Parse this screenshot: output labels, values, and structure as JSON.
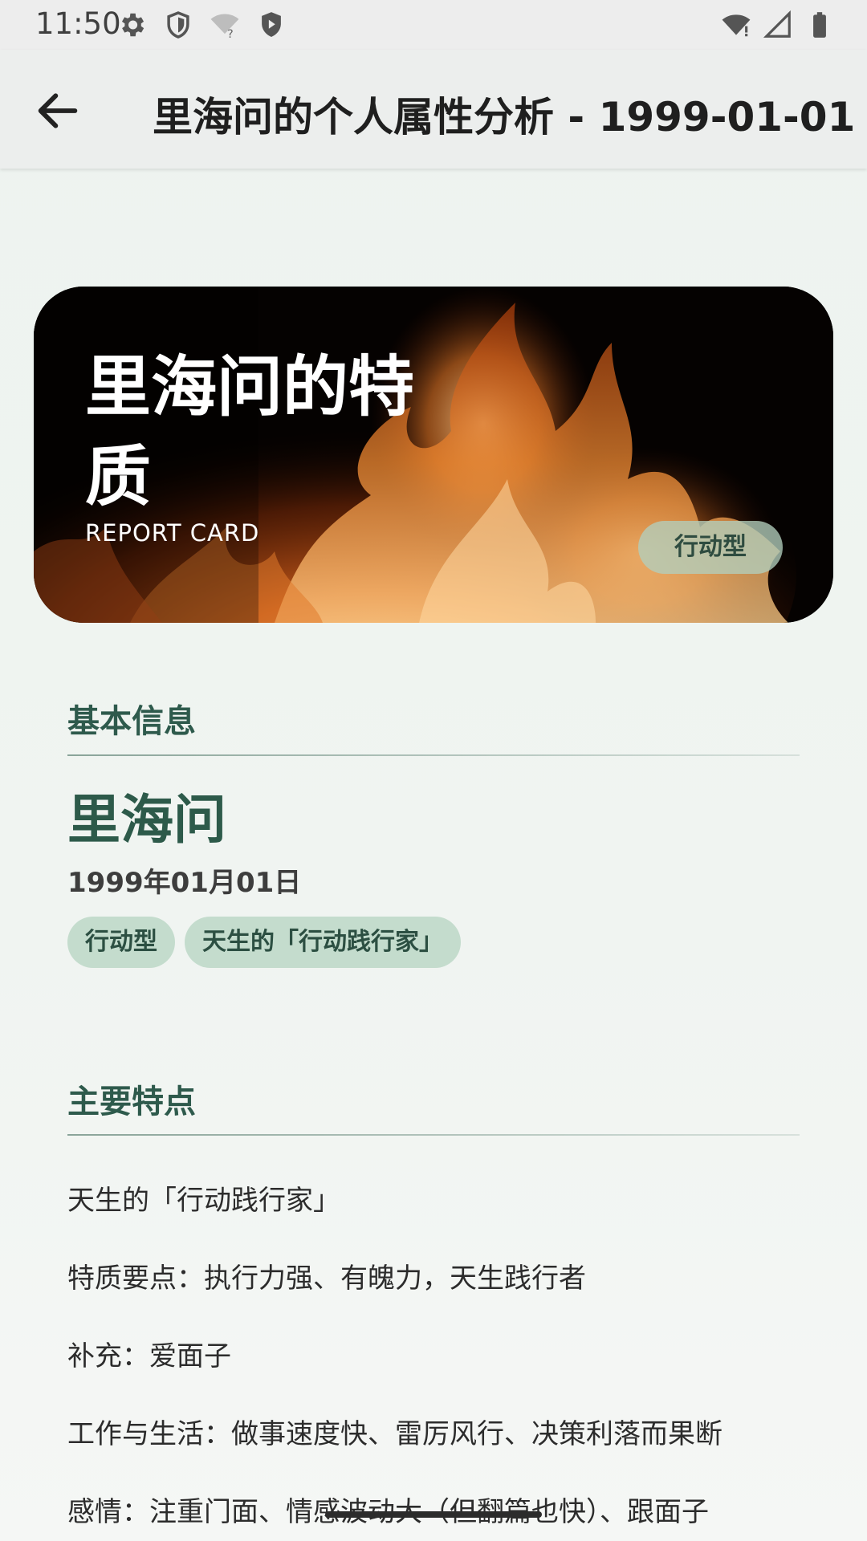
{
  "status_bar": {
    "time": "11:50",
    "left_icons": [
      "settings-icon",
      "shield-icon",
      "wifi-question-icon",
      "vpn-shield-icon"
    ],
    "right_icons": [
      "wifi-icon",
      "signal-icon",
      "battery-icon"
    ]
  },
  "app_bar": {
    "title": "里海问的个人属性分析 - 1999-01-01",
    "back_icon": "arrow-back-icon"
  },
  "hero": {
    "title": "里海问的特质",
    "subtitle": "REPORT CARD",
    "badge": "行动型",
    "background": "fire-flames-image"
  },
  "basic_info": {
    "heading": "基本信息",
    "name": "里海问",
    "birth_date": "1999年01月01日",
    "tags": [
      "行动型",
      "天生的「行动践行家」"
    ]
  },
  "traits": {
    "heading": "主要特点",
    "items": [
      "天生的「行动践行家」",
      "特质要点：执行力强、有魄力，天生践行者",
      "补充：爱面子",
      "工作与生活：做事速度快、雷厉风行、决策利落而果断",
      "感情：注重门面、情感波动大（但翻篇也快）、跟面子"
    ]
  },
  "colors": {
    "accent": "#2e5a4c",
    "tag_bg": "#c4dccd",
    "page_bg": "#f0f4f1"
  }
}
